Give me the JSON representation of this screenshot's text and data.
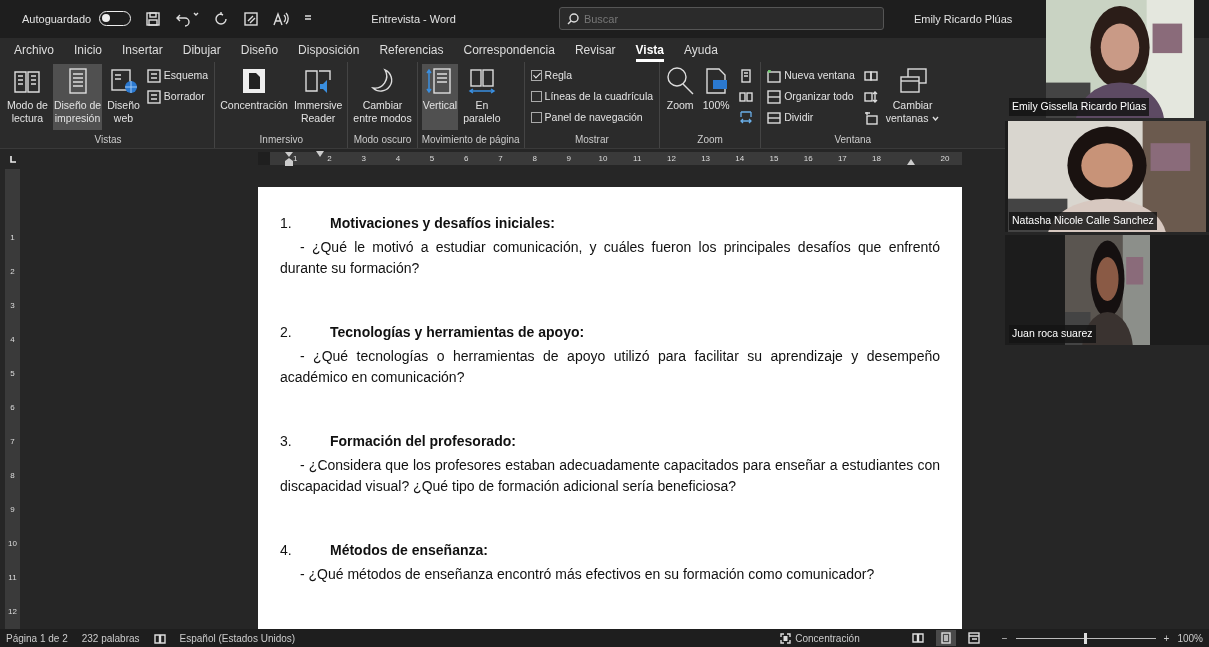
{
  "title_bar": {
    "autosave": {
      "label": "Autoguardado",
      "on": false
    },
    "title": "Entrevista - Word",
    "search": {
      "placeholder": "Buscar"
    },
    "user": "Emily Ricardo Plúas"
  },
  "tabs": [
    {
      "label": "Archivo",
      "selected": false
    },
    {
      "label": "Inicio",
      "selected": false
    },
    {
      "label": "Insertar",
      "selected": false
    },
    {
      "label": "Dibujar",
      "selected": false
    },
    {
      "label": "Diseño",
      "selected": false
    },
    {
      "label": "Disposición",
      "selected": false
    },
    {
      "label": "Referencias",
      "selected": false
    },
    {
      "label": "Correspondencia",
      "selected": false
    },
    {
      "label": "Revisar",
      "selected": false
    },
    {
      "label": "Vista",
      "selected": true
    },
    {
      "label": "Ayuda",
      "selected": false
    }
  ],
  "ribbon": [
    {
      "name": "Vistas",
      "items": [
        {
          "kind": "large",
          "lines": [
            "Modo de",
            "lectura"
          ],
          "selected": false
        },
        {
          "kind": "large",
          "lines": [
            "Diseño de",
            "impresión"
          ],
          "selected": true
        },
        {
          "kind": "large",
          "lines": [
            "Diseño",
            "web"
          ],
          "selected": false
        },
        {
          "kind": "small",
          "label": "Esquema"
        },
        {
          "kind": "small",
          "label": "Borrador"
        }
      ]
    },
    {
      "name": "Inmersivo",
      "items": [
        {
          "kind": "large",
          "lines": [
            "Concentración"
          ],
          "selected": false
        },
        {
          "kind": "large",
          "lines": [
            "Immersive",
            "Reader"
          ],
          "selected": false
        }
      ]
    },
    {
      "name": "Modo oscuro",
      "items": [
        {
          "kind": "large",
          "lines": [
            "Cambiar",
            "entre modos"
          ],
          "selected": false
        }
      ]
    },
    {
      "name": "Movimiento de página",
      "items": [
        {
          "kind": "large",
          "lines": [
            "Vertical"
          ],
          "selected": true
        },
        {
          "kind": "large",
          "lines": [
            "En",
            "paralelo"
          ],
          "selected": false
        }
      ]
    },
    {
      "name": "Mostrar",
      "items": [
        {
          "kind": "checkbox",
          "label": "Regla",
          "checked": true
        },
        {
          "kind": "checkbox",
          "label": "Líneas de la cuadrícula",
          "checked": false
        },
        {
          "kind": "checkbox",
          "label": "Panel de navegación",
          "checked": false
        }
      ]
    },
    {
      "name": "Zoom",
      "items": [
        {
          "kind": "large",
          "lines": [
            "Zoom"
          ],
          "selected": false
        },
        {
          "kind": "large",
          "lines": [
            "100%"
          ],
          "selected": false
        },
        {
          "kind": "icon"
        },
        {
          "kind": "icon"
        },
        {
          "kind": "icon"
        }
      ]
    },
    {
      "name": "Ventana",
      "items": [
        {
          "kind": "small",
          "label": "Nueva ventana"
        },
        {
          "kind": "small",
          "label": "Organizar todo"
        },
        {
          "kind": "small",
          "label": "Dividir"
        },
        {
          "kind": "icon"
        },
        {
          "kind": "icon"
        },
        {
          "kind": "icon"
        },
        {
          "kind": "large",
          "lines": [
            "Cambiar",
            "ventanas"
          ],
          "selected": false
        }
      ]
    }
  ],
  "ruler": {
    "marks": [
      {
        "kind": "number",
        "text": "1"
      },
      {
        "kind": "number",
        "text": "2"
      },
      {
        "kind": "number",
        "text": "3"
      },
      {
        "kind": "number",
        "text": "4"
      },
      {
        "kind": "number",
        "text": "5"
      },
      {
        "kind": "number",
        "text": "6"
      },
      {
        "kind": "number",
        "text": "7"
      },
      {
        "kind": "number",
        "text": "8"
      },
      {
        "kind": "number",
        "text": "9"
      },
      {
        "kind": "number",
        "text": "10"
      },
      {
        "kind": "number",
        "text": "11"
      },
      {
        "kind": "number",
        "text": "12"
      },
      {
        "kind": "number",
        "text": "13"
      },
      {
        "kind": "number",
        "text": "14"
      },
      {
        "kind": "number",
        "text": "15"
      },
      {
        "kind": "number",
        "text": "16"
      },
      {
        "kind": "number",
        "text": "17"
      },
      {
        "kind": "number",
        "text": "18"
      },
      {
        "kind": "indent_marker"
      },
      {
        "kind": "number",
        "text": "20"
      }
    ]
  },
  "vertical_ruler": {
    "numbers": [
      "1",
      "2",
      "3",
      "4",
      "5",
      "6",
      "7",
      "8",
      "9",
      "10",
      "11",
      "12"
    ]
  },
  "document": {
    "sections": [
      {
        "number": "1.",
        "heading": "Motivaciones y desafíos iniciales:",
        "question": "- ¿Qué le motivó a estudiar comunicación, y cuáles fueron los principales desafíos que enfrentó durante su formación?"
      },
      {
        "number": "2.",
        "heading": "Tecnologías y herramientas de apoyo:",
        "question": "- ¿Qué tecnologías o herramientas de apoyo utilizó para facilitar su aprendizaje y desempeño académico en comunicación?"
      },
      {
        "number": "3.",
        "heading": "Formación del profesorado:",
        "question": "- ¿Considera que los profesores estaban adecuadamente capacitados para enseñar a estudiantes con discapacidad visual? ¿Qué tipo de formación adicional sería beneficiosa?"
      },
      {
        "number": "4.",
        "heading": "Métodos de enseñanza:",
        "question": "- ¿Qué métodos de enseñanza encontró más efectivos en su formación como comunicador?"
      }
    ]
  },
  "status_bar": {
    "page": "Página 1 de 2",
    "words": "232 palabras",
    "language": "Español (Estados Unidos)",
    "focus": "Concentración",
    "views": [
      {
        "selected": false
      },
      {
        "selected": true
      },
      {
        "selected": false
      }
    ],
    "zoom": {
      "minus": "−",
      "plus": "+",
      "level": 0.5,
      "reading": "100%"
    }
  },
  "participants": [
    {
      "name": "Emily Gissella Ricardo Plúas"
    },
    {
      "name": "Natasha Nicole Calle Sanchez"
    },
    {
      "name": "Juan roca suarez"
    }
  ]
}
